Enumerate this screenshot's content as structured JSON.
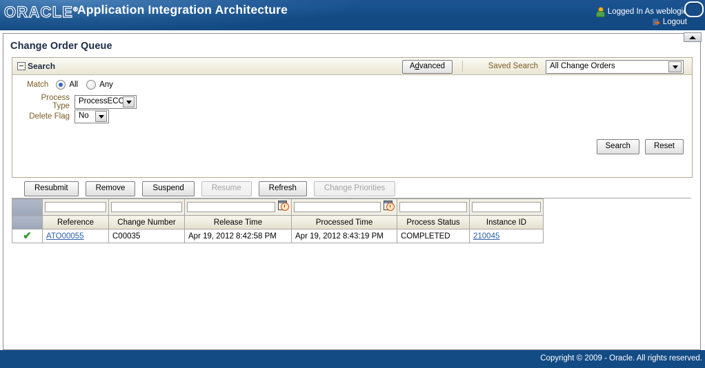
{
  "brand": {
    "logo_text": "ORACLE",
    "logo_reg": "®",
    "app_title": "Application Integration Architecture",
    "logged_in_text": "Logged In As  weblogic",
    "logout_label": "Logout"
  },
  "page": {
    "title": "Change Order Queue"
  },
  "search": {
    "header_label": "Search",
    "advanced_pre": "A",
    "advanced_key": "d",
    "advanced_post": "vanced",
    "advanced_label": "Advanced",
    "saved_search_label": "Saved Search",
    "saved_search_value": "All Change Orders",
    "match_label": "Match",
    "match_all_label": "All",
    "match_any_label": "Any",
    "match_selected": "All",
    "process_type_label": "Process Type",
    "process_type_value": "ProcessECO",
    "delete_flag_label": "Delete Flag",
    "delete_flag_value": "No",
    "search_button": "Search",
    "reset_button": "Reset"
  },
  "toolbar": {
    "buttons": [
      {
        "label": "Resubmit",
        "enabled": true
      },
      {
        "label": "Remove",
        "enabled": true
      },
      {
        "label": "Suspend",
        "enabled": true
      },
      {
        "label": "Resume",
        "enabled": false
      },
      {
        "label": "Refresh",
        "enabled": true
      },
      {
        "label": "Change Priorities",
        "enabled": false
      }
    ]
  },
  "table": {
    "columns": [
      {
        "label": "Reference",
        "filter_value": "",
        "has_datepicker": false
      },
      {
        "label": "Change Number",
        "filter_value": "",
        "has_datepicker": false
      },
      {
        "label": "Release Time",
        "filter_value": "",
        "has_datepicker": true
      },
      {
        "label": "Processed Time",
        "filter_value": "",
        "has_datepicker": true
      },
      {
        "label": "Process Status",
        "filter_value": "",
        "has_datepicker": false
      },
      {
        "label": "Instance ID",
        "filter_value": "",
        "has_datepicker": false
      }
    ],
    "rows": [
      {
        "selected_mark": "✔",
        "reference": "ATO00055",
        "change_number": "C00035",
        "release_time": "Apr 19, 2012 8:42:58 PM",
        "processed_time": "Apr 19, 2012 8:43:19 PM",
        "process_status": "COMPLETED",
        "instance_id": "210045"
      }
    ]
  },
  "footer": {
    "copyright": "Copyright © 2009 - Oracle. All rights reserved."
  },
  "colors": {
    "brand_blue": "#134b84",
    "link_blue": "#2b5faa",
    "label_brown": "#7a5c23",
    "check_green": "#2e9a2e"
  }
}
